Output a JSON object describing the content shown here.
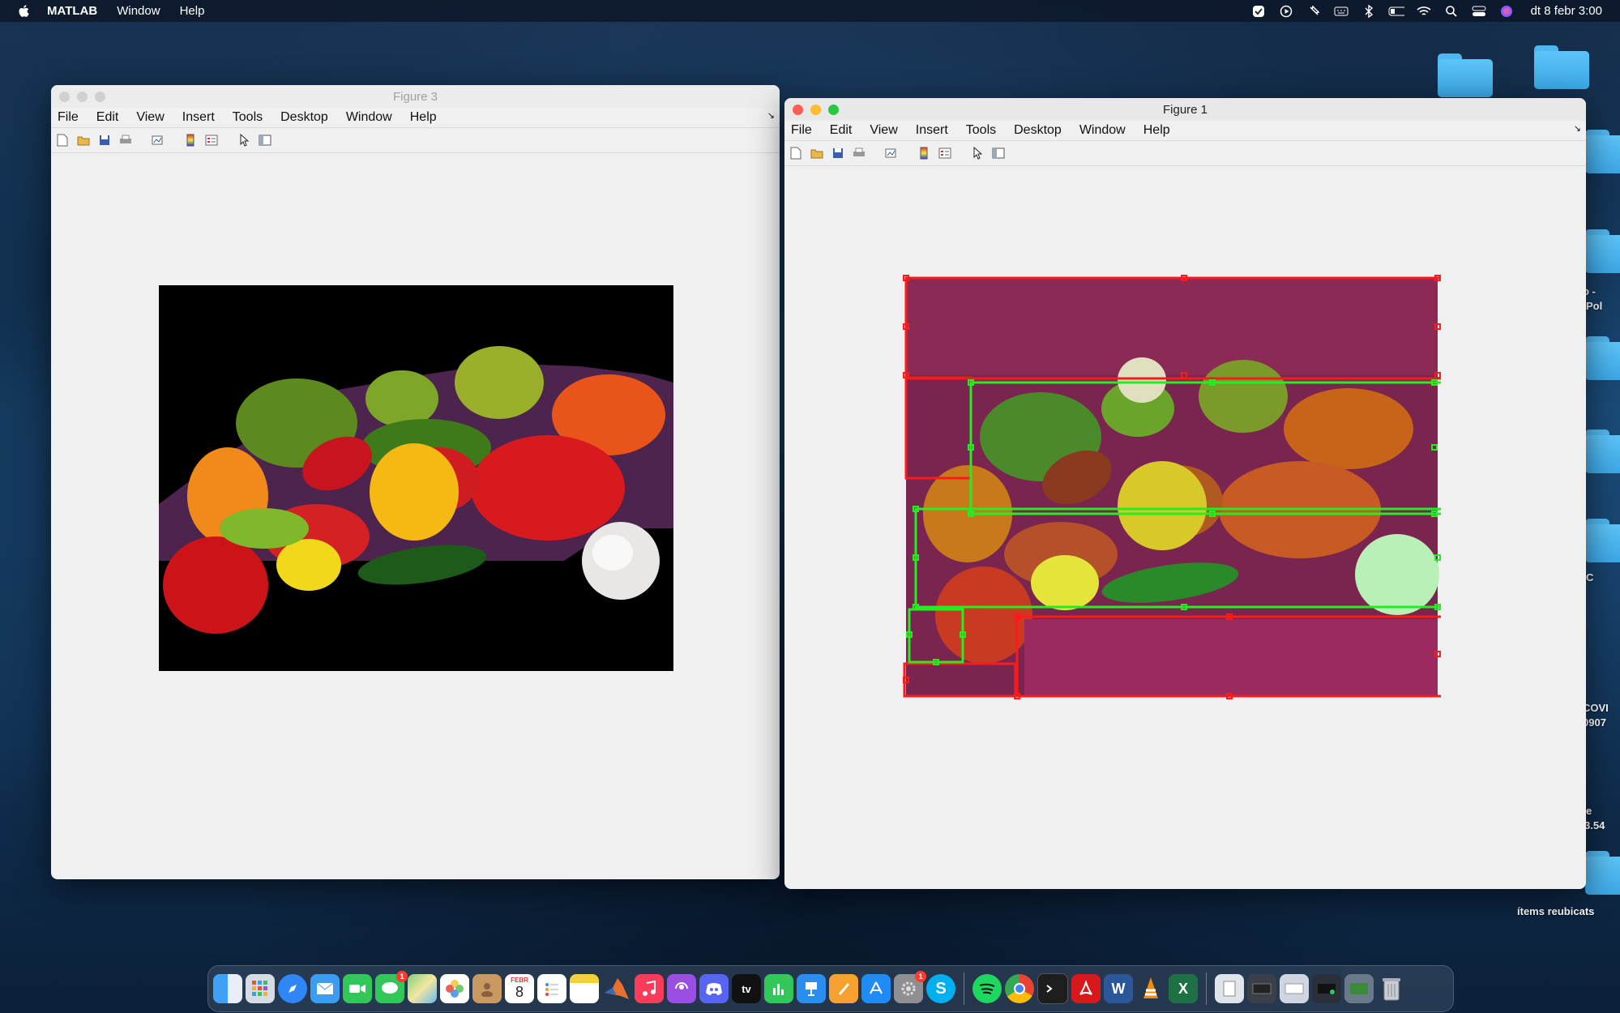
{
  "menubar": {
    "app_name": "MATLAB",
    "menus": [
      "Window",
      "Help"
    ],
    "clock": "dt 8 febr  3:00"
  },
  "desktop": {
    "side_labels": [
      "o -",
      "Pol",
      "C",
      "COVI",
      "0907",
      "e",
      "3.54"
    ],
    "trash_label": "ítems reubicats"
  },
  "figure3": {
    "title": "Figure 3",
    "menus": [
      "File",
      "Edit",
      "View",
      "Insert",
      "Tools",
      "Desktop",
      "Window",
      "Help"
    ]
  },
  "figure1": {
    "title": "Figure 1",
    "menus": [
      "File",
      "Edit",
      "View",
      "Insert",
      "Tools",
      "Desktop",
      "Window",
      "Help"
    ]
  },
  "toolbar_icons": [
    "new-figure-icon",
    "open-file-icon",
    "save-icon",
    "print-icon",
    "link-plot-icon",
    "colorbar-icon",
    "legend-icon",
    "edit-plot-icon",
    "property-editor-icon"
  ],
  "dock": {
    "apps": [
      "Finder",
      "Launchpad",
      "Safari",
      "Mail",
      "FaceTime",
      "Messages",
      "Maps",
      "Photos",
      "Contacts",
      "Calendar",
      "Reminders",
      "Notes",
      "MATLAB",
      "Music",
      "Podcasts",
      "Discord",
      "TV",
      "Numbers",
      "Keynote",
      "Pages",
      "App Store",
      "System Preferences",
      "Skype",
      "Spotify",
      "Chrome",
      "Terminal",
      "Acrobat",
      "Word",
      "VLC",
      "Excel",
      "Documents",
      "Recent",
      "Downloads",
      "Window",
      "Preview",
      "Trash"
    ],
    "calendar_day": "8",
    "calendar_month": "FEBR",
    "messages_badge": "1",
    "prefs_badge": "1",
    "tv_label": "tv"
  },
  "colors": {
    "roi_red": "#ff1a1a",
    "roi_green": "#22ee22",
    "window_bg": "#f0f0f0"
  }
}
